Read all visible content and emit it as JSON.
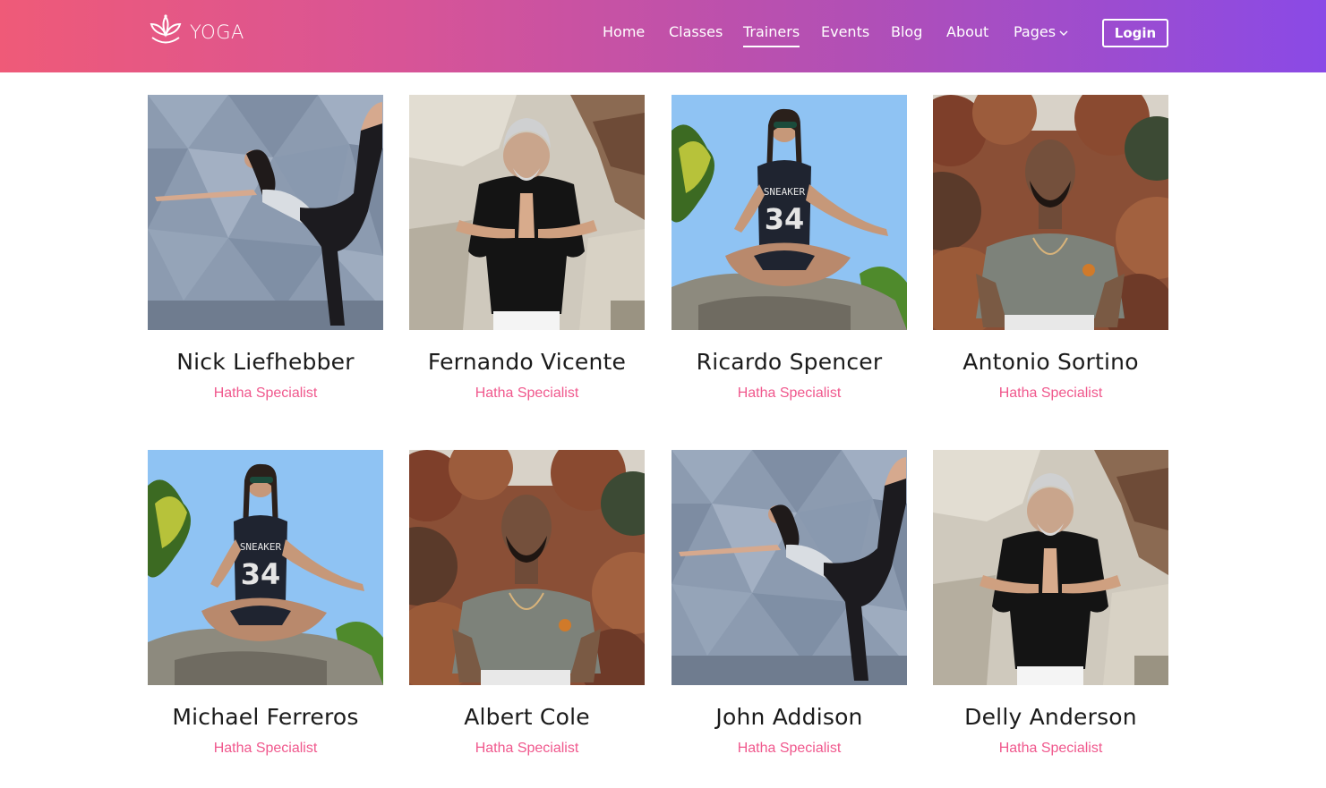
{
  "brand": {
    "name": "YOGA"
  },
  "nav": {
    "items": [
      {
        "label": "Home"
      },
      {
        "label": "Classes"
      },
      {
        "label": "Trainers"
      },
      {
        "label": "Events"
      },
      {
        "label": "Blog"
      },
      {
        "label": "About"
      },
      {
        "label": "Pages"
      }
    ],
    "active": "Trainers",
    "login_label": "Login"
  },
  "colors": {
    "header_gradient": [
      "#ef5a78",
      "#d85496",
      "#b14fb6",
      "#8a4ae6"
    ],
    "accent_pink": "#f0588d",
    "name_text": "#1b1b1b"
  },
  "trainers": [
    {
      "name": "Nick Liefhebber",
      "role": "Hatha Specialist",
      "photo": "dancer-pose-grey-wall"
    },
    {
      "name": "Fernando Vicente",
      "role": "Hatha Specialist",
      "photo": "prayer-hands-stone-wall"
    },
    {
      "name": "Ricardo Spencer",
      "role": "Hatha Specialist",
      "photo": "lotus-pose-blue-sky"
    },
    {
      "name": "Antonio Sortino",
      "role": "Hatha Specialist",
      "photo": "man-autumn-forest"
    },
    {
      "name": "Michael Ferreros",
      "role": "Hatha Specialist",
      "photo": "lotus-pose-blue-sky"
    },
    {
      "name": "Albert Cole",
      "role": "Hatha Specialist",
      "photo": "man-autumn-forest"
    },
    {
      "name": "John Addison",
      "role": "Hatha Specialist",
      "photo": "dancer-pose-grey-wall"
    },
    {
      "name": "Delly Anderson",
      "role": "Hatha Specialist",
      "photo": "prayer-hands-stone-wall"
    }
  ]
}
